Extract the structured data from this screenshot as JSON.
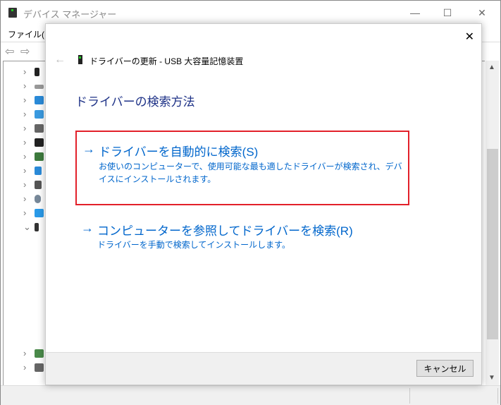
{
  "window": {
    "title": "デバイス マネージャー",
    "menu": [
      "ファイル(F)"
    ],
    "minimize": "—",
    "maximize": "☐",
    "close": "✕"
  },
  "tree": {
    "collapsed_chevron": "›",
    "expanded_chevron": "⌄"
  },
  "dialog": {
    "close": "✕",
    "back": "←",
    "header": "ドライバーの更新 - USB 大容量記憶装置",
    "heading": "ドライバーの検索方法",
    "options": [
      {
        "arrow": "→",
        "title": "ドライバーを自動的に検索(S)",
        "description": "お使いのコンピューターで、使用可能な最も適したドライバーが検索され、デバイスにインストールされます。",
        "highlighted": true,
        "highlight_color": "#e2202a"
      },
      {
        "arrow": "→",
        "title": "コンピューターを参照してドライバーを検索(R)",
        "description": "ドライバーを手動で検索してインストールします。"
      }
    ],
    "cancel_label": "キャンセル"
  },
  "colors": {
    "link": "#0066cc",
    "heading": "#1e3287"
  }
}
